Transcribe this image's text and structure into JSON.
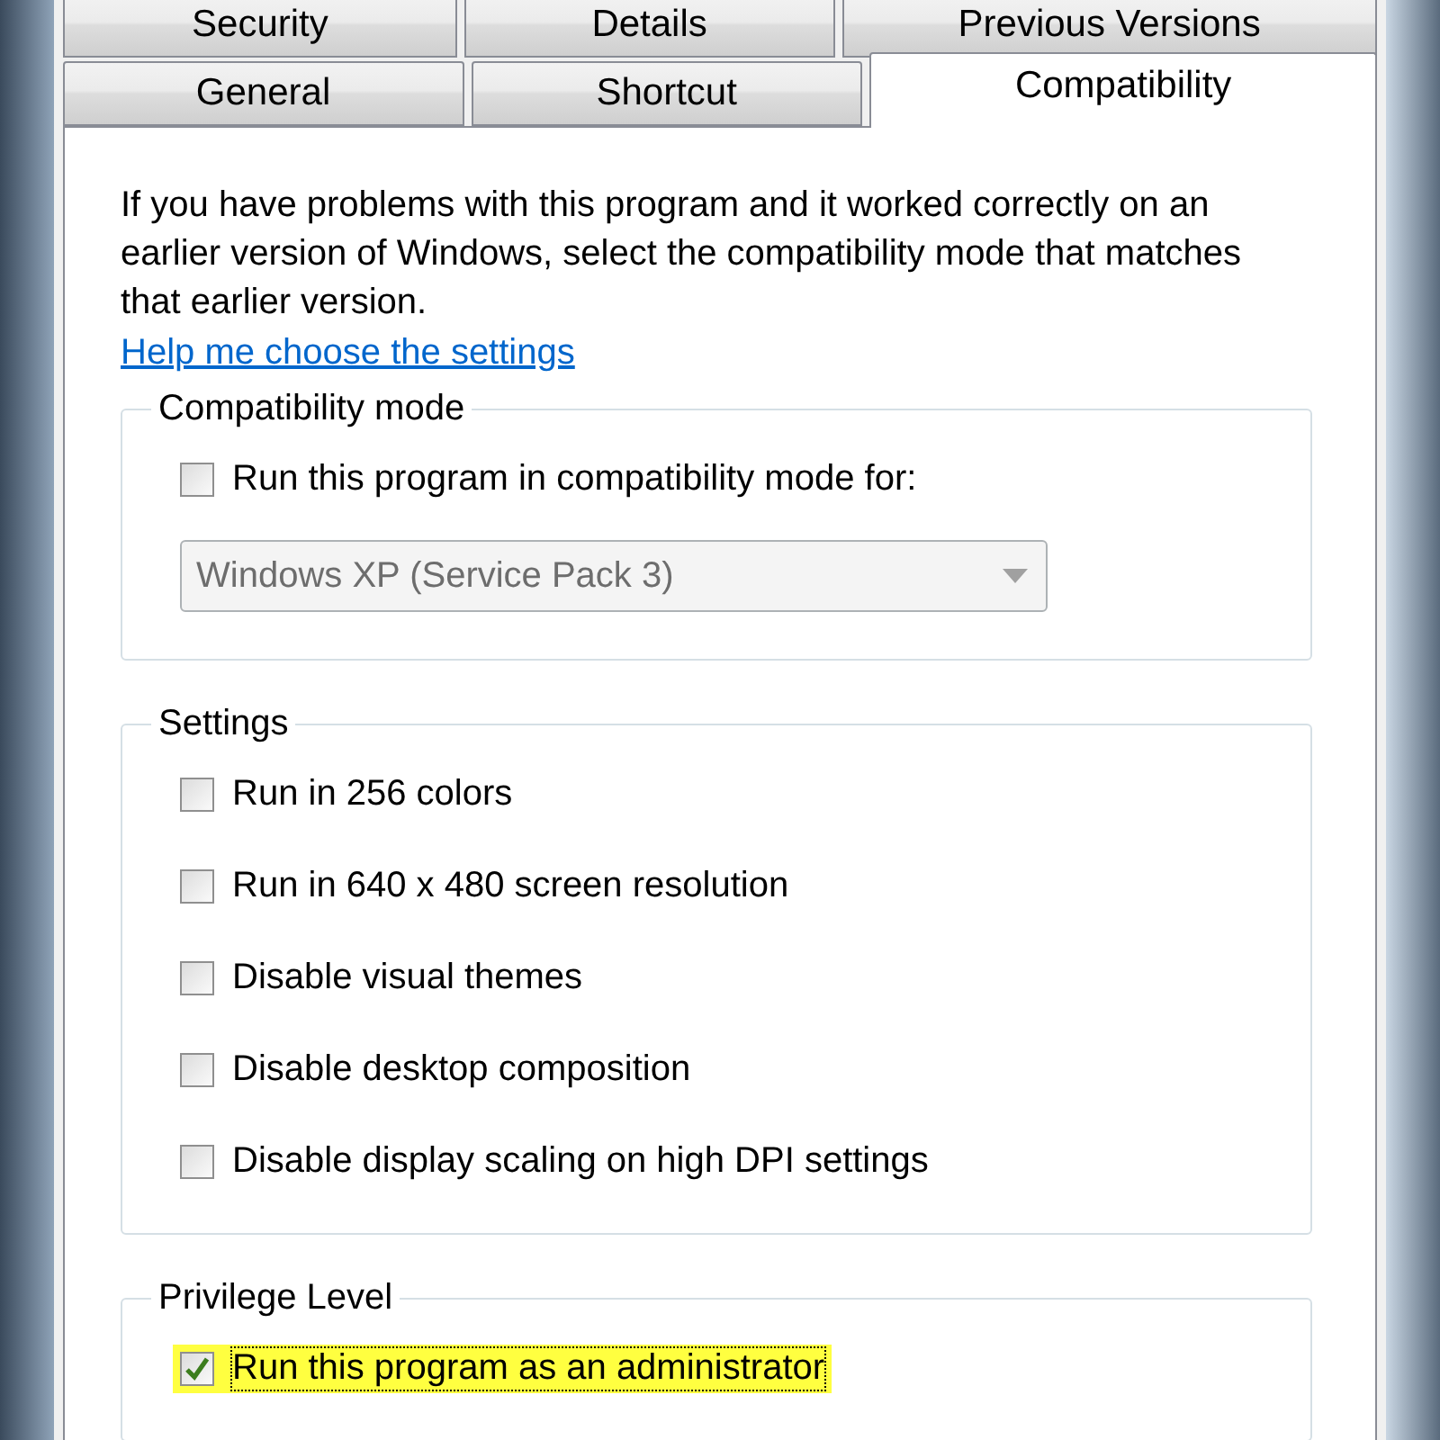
{
  "tabs_back_row": [
    {
      "label": "Security",
      "selected": false
    },
    {
      "label": "Details",
      "selected": false
    },
    {
      "label": "Previous Versions",
      "selected": false
    }
  ],
  "tabs_front_row": [
    {
      "label": "General",
      "selected": false
    },
    {
      "label": "Shortcut",
      "selected": false
    },
    {
      "label": "Compatibility",
      "selected": true
    }
  ],
  "intro": "If you have problems with this program and it worked correctly on an earlier version of Windows, select the compatibility mode that matches that earlier version.",
  "help_link": "Help me choose the settings",
  "groups": [
    {
      "title": "Compatibility mode",
      "kind": "mode",
      "options": [
        {
          "label": "Run this program in compatibility mode for:",
          "checked": false,
          "highlighted": false
        }
      ],
      "dropdown": {
        "value": "Windows XP (Service Pack 3)",
        "disabled": true
      }
    },
    {
      "title": "Settings",
      "kind": "list",
      "options": [
        {
          "label": "Run in 256 colors",
          "checked": false,
          "highlighted": false
        },
        {
          "label": "Run in 640 x 480 screen resolution",
          "checked": false,
          "highlighted": false
        },
        {
          "label": "Disable visual themes",
          "checked": false,
          "highlighted": false
        },
        {
          "label": "Disable desktop composition",
          "checked": false,
          "highlighted": false
        },
        {
          "label": "Disable display scaling on high DPI settings",
          "checked": false,
          "highlighted": false
        }
      ]
    },
    {
      "title": "Privilege Level",
      "kind": "list",
      "options": [
        {
          "label": "Run this program as an administrator",
          "checked": true,
          "highlighted": true
        }
      ]
    }
  ]
}
